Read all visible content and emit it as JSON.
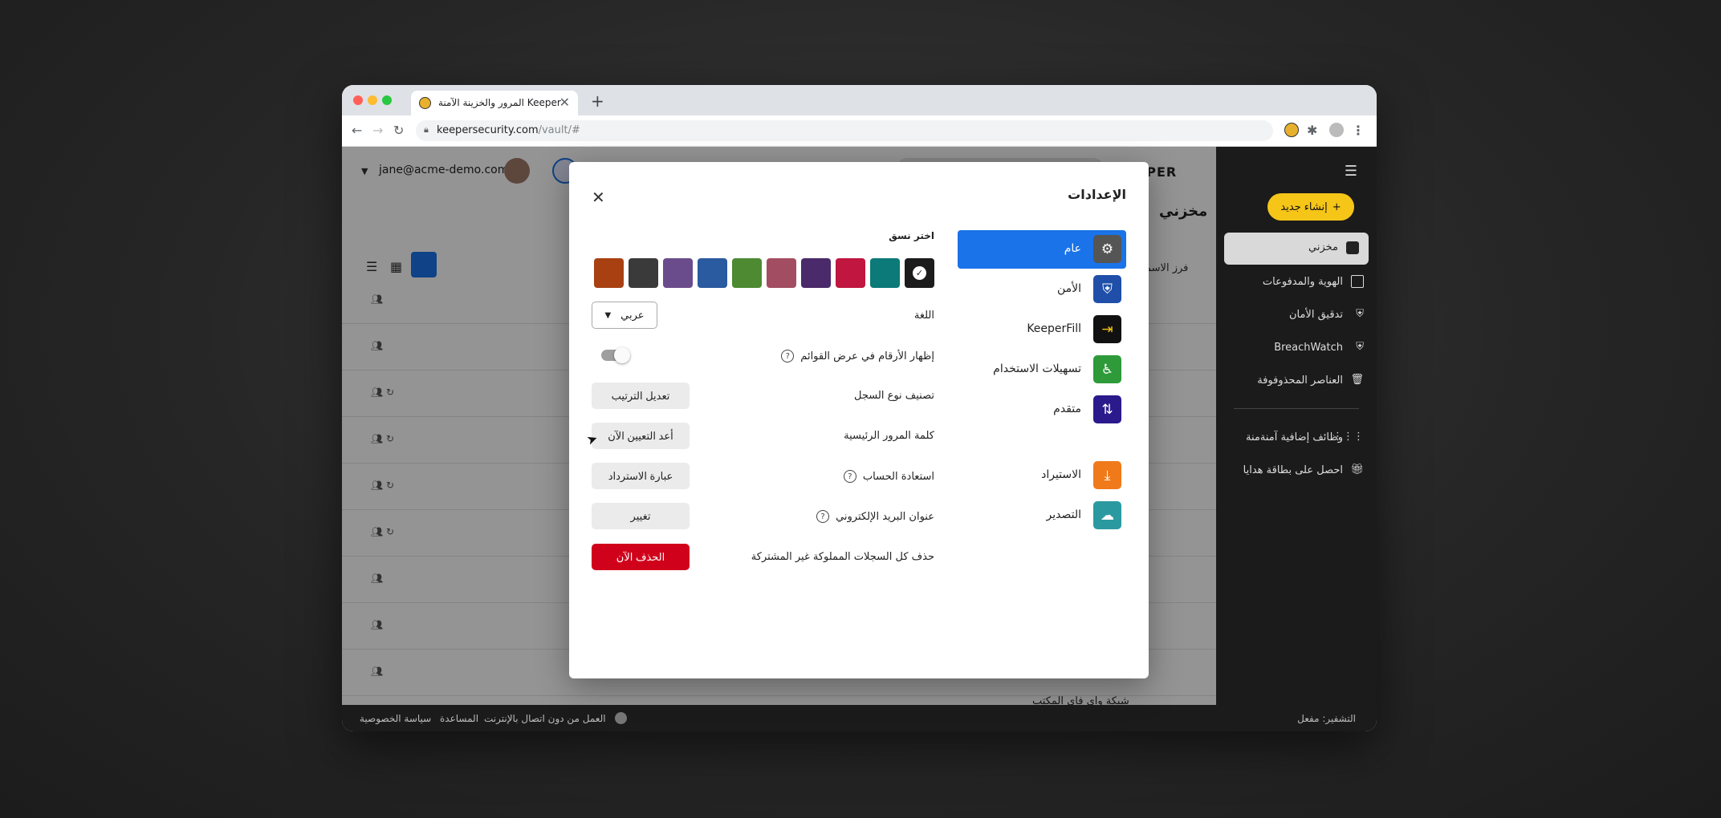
{
  "browser": {
    "tab_title": "المرور والخزينة الآمنة Keeper",
    "tab_close": "✕",
    "new_tab": "+",
    "url_host": "keepersecurity.com",
    "url_path": "/vault/#"
  },
  "header": {
    "user_email": "jane@acme-demo.com",
    "brand": "KEEPER"
  },
  "main": {
    "title": "مخزني",
    "sort_label": "فرز الاسم",
    "partial_row_text": "شبكة واي فاي المكتب"
  },
  "sidebar": {
    "create_button": "إنشاء جديد",
    "items": [
      {
        "label": "مخزني"
      },
      {
        "label": "الهوية والمدفوعات"
      },
      {
        "label": "تدقيق الأمان"
      },
      {
        "label": "BreachWatch"
      },
      {
        "label": "العناصر المحذوفوفة"
      }
    ],
    "extras": [
      {
        "label": "وظائف إضافية آمنةمنة"
      },
      {
        "label": "احصل على بطاقة هدايا"
      }
    ]
  },
  "footer": {
    "encryption_label": "التشفير:",
    "encryption_value": "مفعل",
    "offline": "العمل من دون اتصال بالإنترنت",
    "help": "المساعدة",
    "privacy": "سياسة الخصوصية"
  },
  "modal": {
    "title": "الإعدادات",
    "close": "✕",
    "nav": [
      {
        "label": "عام",
        "color": "#555555"
      },
      {
        "label": "الأمن",
        "color": "#1f4fa8"
      },
      {
        "label": "KeeperFill",
        "color": "#111111"
      },
      {
        "label": "تسهيلات الاستخدام",
        "color": "#2e9a3a"
      },
      {
        "label": "متقدم",
        "color": "#2a1a8c"
      },
      {
        "label": "الاستيراد",
        "color": "#f07a1a"
      },
      {
        "label": "التصدير",
        "color": "#2a9aa0"
      }
    ],
    "theme_label": "اختر نسق",
    "swatches": [
      "#1c1c1c",
      "#0b7a78",
      "#c0163f",
      "#4a2a6a",
      "#a34d62",
      "#4d8a32",
      "#2a5aa0",
      "#6a4c8c",
      "#3a3a3a",
      "#a84012"
    ],
    "language_label": "اللغة",
    "language_value": "عربي",
    "show_numbers_label": "إظهار الأرقام في عرض القوائم",
    "record_type_label": "تصنيف نوع السجل",
    "record_type_button": "تعديل الترتيب",
    "master_password_label": "كلمة المرور الرئيسية",
    "master_password_button": "أعد التعيين الآن",
    "account_recovery_label": "استعادة الحساب",
    "account_recovery_button": "عبارة الاسترداد",
    "email_label": "عنوان البريد الإلكتروني",
    "email_button": "تغيير",
    "delete_label": "حذف كل السجلات المملوكة غير المشتركة",
    "delete_button": "الحذف الآن"
  }
}
